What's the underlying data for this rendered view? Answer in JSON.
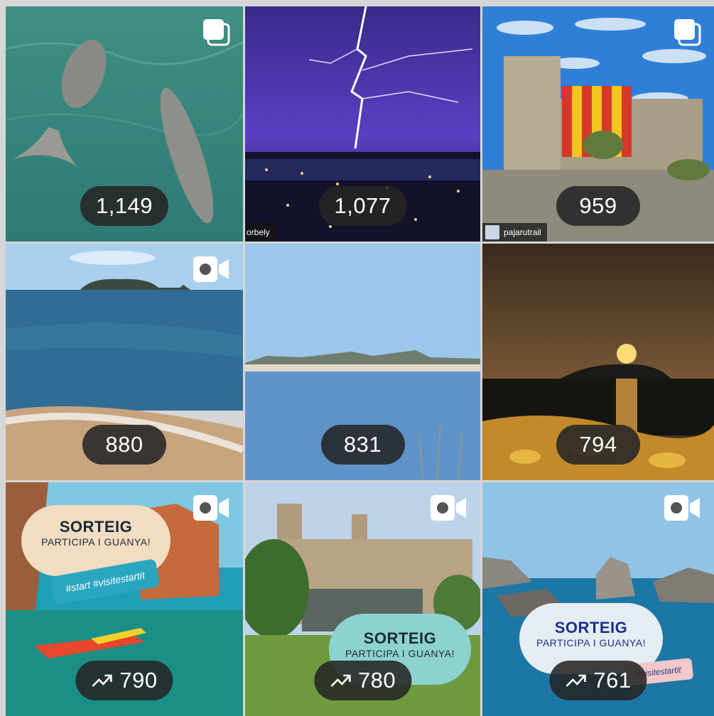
{
  "grid": {
    "tiles": [
      {
        "count": "1,149",
        "badge": "multiple-photos-icon",
        "trending": false,
        "tag": ""
      },
      {
        "count": "1,077",
        "badge": "",
        "trending": false,
        "tag": "orbely"
      },
      {
        "count": "959",
        "badge": "multiple-photos-icon",
        "trending": false,
        "tag": "pajarutrail"
      },
      {
        "count": "880",
        "badge": "video-icon",
        "trending": false,
        "tag": ""
      },
      {
        "count": "831",
        "badge": "",
        "trending": false,
        "tag": ""
      },
      {
        "count": "794",
        "badge": "",
        "trending": false,
        "tag": ""
      },
      {
        "count": "790",
        "badge": "video-icon",
        "trending": true,
        "tag": ""
      },
      {
        "count": "780",
        "badge": "video-icon",
        "trending": true,
        "tag": ""
      },
      {
        "count": "761",
        "badge": "video-icon",
        "trending": true,
        "tag": ""
      }
    ]
  },
  "promos": {
    "tile7": {
      "title": "SORTEIG",
      "subtitle": "PARTICIPA I GUANYA!",
      "hashtags": "#start #visitestartit"
    },
    "tile8": {
      "title": "SORTEIG",
      "subtitle": "PARTICIPA I GUANYA!"
    },
    "tile9": {
      "title": "SORTEIG",
      "subtitle": "PARTICIPA I GUANYA!",
      "hashtags": "#visitestartit"
    }
  },
  "colors": {
    "pill": "#262626",
    "background": "#d6d6d6",
    "icon": "#ffffff"
  }
}
